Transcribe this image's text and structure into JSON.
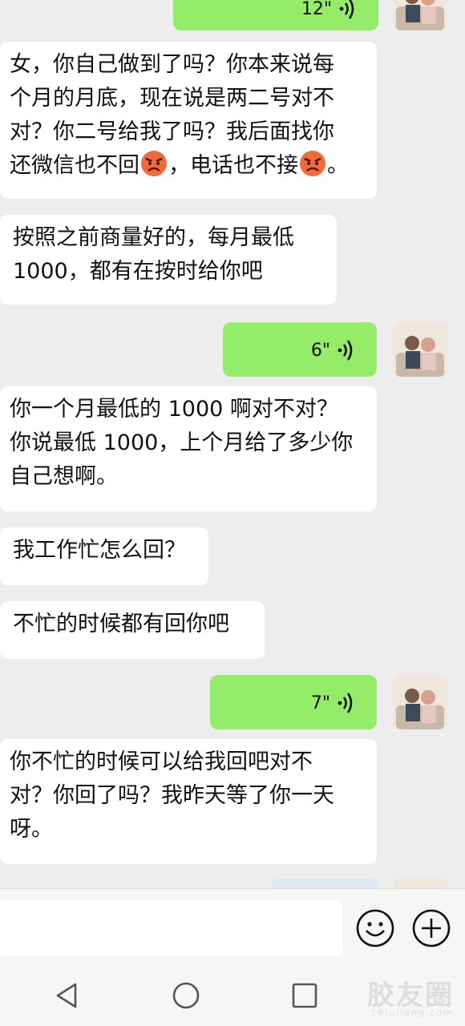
{
  "messages": [
    {
      "type": "voice",
      "dir": "out",
      "duration": "12\""
    },
    {
      "type": "text",
      "dir": "in",
      "lines": [
        "女，你自己做到了吗？你本来说每",
        "个月的月底，现在说是两二号对不",
        "对？你二号给我了吗？我后面找你"
      ],
      "last_line_parts": [
        "还微信也不回",
        "，电话也不接",
        "。"
      ]
    },
    {
      "type": "text",
      "dir": "in",
      "lines": [
        "按照之前商量好的，每月最低",
        "1000，都有在按时给你吧"
      ]
    },
    {
      "type": "voice",
      "dir": "out",
      "duration": "6\""
    },
    {
      "type": "text",
      "dir": "in",
      "lines": [
        "你一个月最低的 1000 啊对不对？",
        "你说最低 1000，上个月给了多少你",
        "自己想啊。"
      ]
    },
    {
      "type": "text",
      "dir": "in",
      "lines": [
        "我工作忙怎么回？"
      ]
    },
    {
      "type": "text",
      "dir": "in",
      "lines": [
        "不忙的时候都有回你吧"
      ]
    },
    {
      "type": "voice",
      "dir": "out",
      "duration": "7\""
    },
    {
      "type": "text",
      "dir": "in",
      "lines": [
        "你不忙的时候可以给我回吧对不",
        "对？你回了吗？我昨天等了你一天",
        "呀。"
      ]
    }
  ],
  "icons": {
    "emoji": "angry-face-icon",
    "voice": "voice-wave-icon",
    "emoji_button": "smiley-icon",
    "more_button": "plus-icon",
    "nav_back": "triangle-back-icon",
    "nav_home": "circle-home-icon",
    "nav_recent": "square-recent-icon"
  },
  "colors": {
    "outgoing": "#95ec69",
    "incoming": "#ffffff",
    "background": "#ededed"
  },
  "watermark": {
    "main": "胶友圈",
    "sub": "18iuliang.com"
  }
}
